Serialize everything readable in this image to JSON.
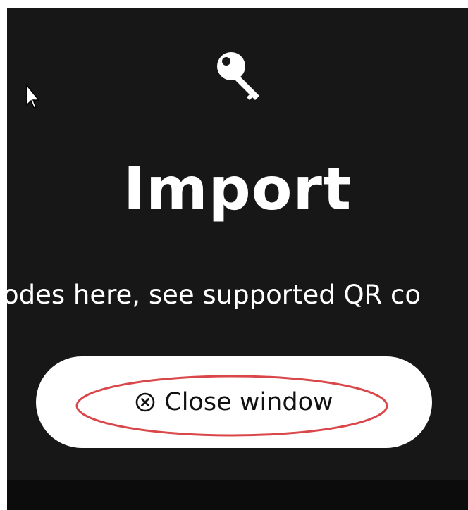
{
  "dialog": {
    "title": "Import",
    "subtitle": "odes here, see supported QR co",
    "close_label": "Close window"
  },
  "icons": {
    "header": "key-icon",
    "close": "circle-x-icon",
    "pointer": "mouse-cursor-icon"
  },
  "colors": {
    "background": "#171717",
    "text": "#ffffff",
    "button_bg": "#ffffff",
    "button_text": "#111111",
    "highlight": "#d9474a"
  }
}
